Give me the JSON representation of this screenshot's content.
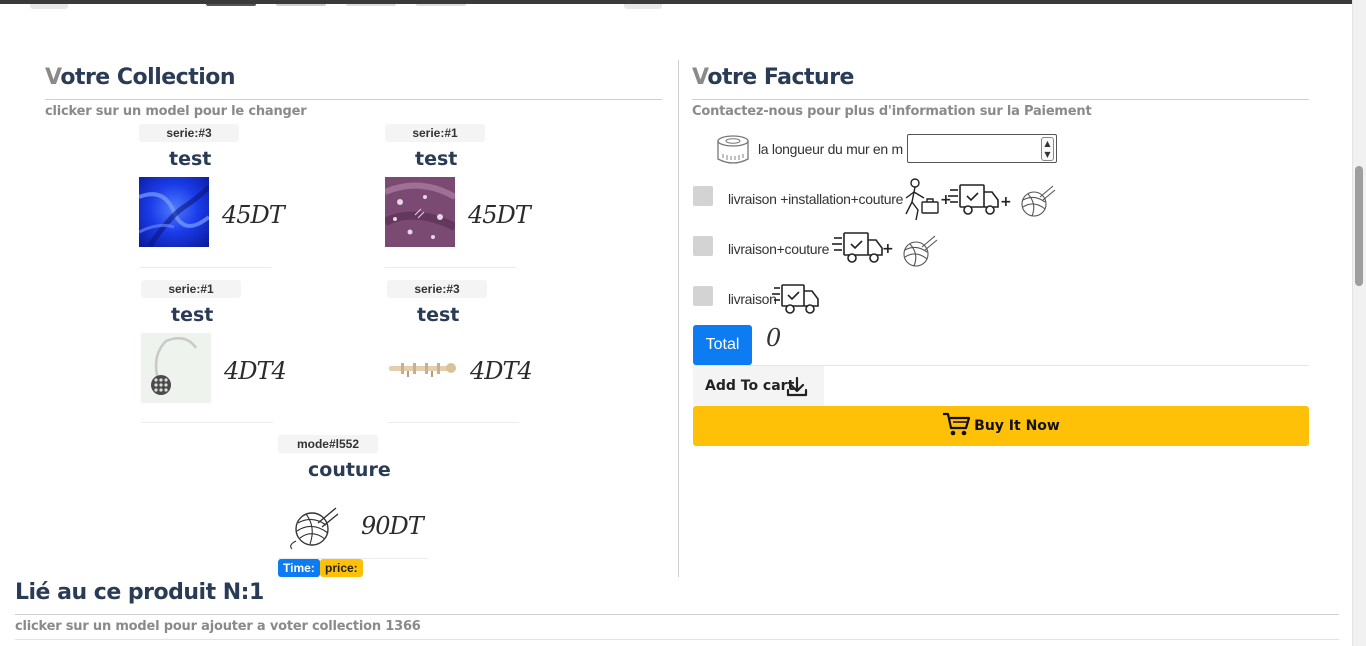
{
  "collection": {
    "title_first": "V",
    "title_rest": "otre Collection",
    "subtitle": "clicker sur un model pour le changer",
    "items": [
      {
        "badge": "serie:#3",
        "name": "test",
        "price": "45DT",
        "image": "blue-satin-fabric"
      },
      {
        "badge": "serie:#1",
        "name": "test",
        "price": "45DT",
        "image": "purple-floral-fabric"
      },
      {
        "badge": "serie:#1",
        "name": "test",
        "price": "4DT4",
        "image": "curtain-tieback"
      },
      {
        "badge": "serie:#3",
        "name": "test",
        "price": "4DT4",
        "image": "curtain-rod"
      },
      {
        "badge": "mode#l552",
        "name": "couture",
        "price": "90DT",
        "image": "yarn-ball-icon"
      }
    ],
    "chips": {
      "time": "Time:",
      "price": "price:"
    }
  },
  "facture": {
    "title_first": "V",
    "title_rest": "otre Facture",
    "subtitle": "Contactez-nous pour plus d'information sur la Paiement",
    "wall_length_label": "la longueur du mur en m",
    "wall_length_value": "",
    "options": [
      {
        "label": "livraison +installation+couture",
        "checked": false
      },
      {
        "label": "livraison+couture",
        "checked": false
      },
      {
        "label": "livraison",
        "checked": false
      }
    ],
    "total_label": "Total",
    "total_value": "0",
    "add_to_cart_label": "Add To cart",
    "buy_now_label": "Buy It Now"
  },
  "related": {
    "title": "Lié au ce produit N:1",
    "subtitle": "clicker sur un model pour ajouter a voter collection 1366"
  },
  "colors": {
    "accent_blue": "#0d7bf2",
    "buy_yellow": "#ffc107",
    "heading": "#2a3b55",
    "muted": "#8a8a8a"
  }
}
